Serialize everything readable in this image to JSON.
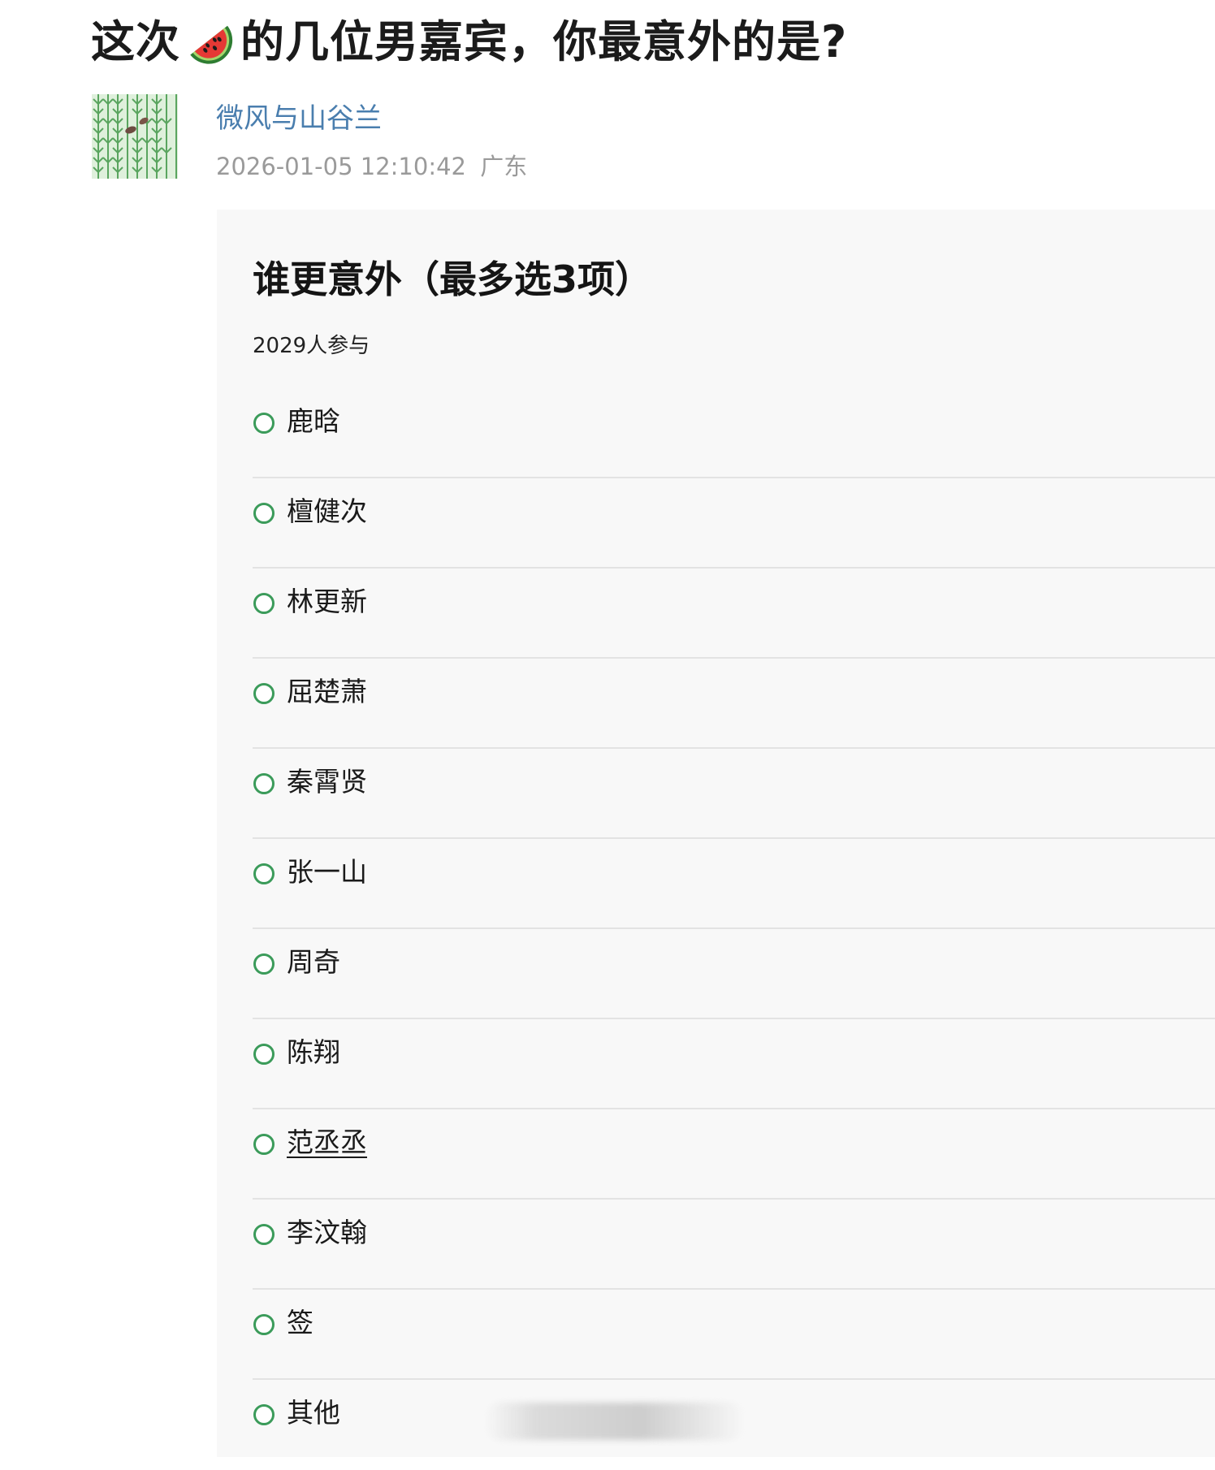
{
  "post": {
    "title_before": "这次",
    "title_emoji": "watermelon-icon",
    "title_after": "的几位男嘉宾，你最意外的是?",
    "author": "微风与山谷兰",
    "timestamp": "2026-01-05 12:10:42",
    "location": "广东"
  },
  "poll": {
    "title": "谁更意外（最多选3项）",
    "participants": "2029人参与",
    "options": [
      {
        "label": "鹿晗"
      },
      {
        "label": "檀健次"
      },
      {
        "label": "林更新"
      },
      {
        "label": "屈楚萧"
      },
      {
        "label": "秦霄贤"
      },
      {
        "label": "张一山"
      },
      {
        "label": "周奇"
      },
      {
        "label": "陈翔"
      },
      {
        "label": "范丞丞"
      },
      {
        "label": "李汶翰"
      },
      {
        "label": "签"
      },
      {
        "label": "其他"
      }
    ]
  },
  "colors": {
    "author_link": "#4a7eae",
    "radio_border": "#3b9b5a",
    "card_background": "#f8f8f8",
    "meta_text": "#9a9a9a"
  }
}
